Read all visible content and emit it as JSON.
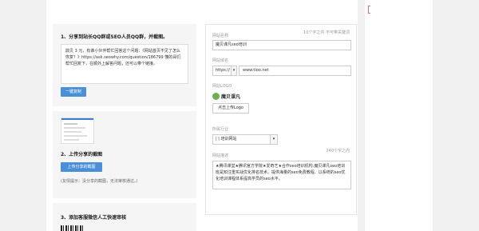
{
  "step1": {
    "title": "1、分享到站长QQ群或SEO人员QQ群，并截图。",
    "share_text": "鼎贝 3 元，有谁小伙伴帮忙回答这个问题：《网站首页不见了怎么恢复？》https://ask.seowhy.com/question/186799 懂的哥们帮忙回复下，在顺外上解答问题，还可以带个链接。",
    "copy_button": "一键复制"
  },
  "step2": {
    "title": "2、上传分享的截图",
    "upload_button": "上传分享的截图",
    "hint": "(友情提示：没分享的截图，无法审核通过。)"
  },
  "step3": {
    "title": "3、添加客服微信人工快速审核"
  },
  "form": {
    "site_name_label": "网站名称",
    "site_name_note": "10个字之内 不可带关键词",
    "site_name_value": "魔贝课凡seo培训",
    "domain_label": "网站域名",
    "protocol_value": "https://",
    "domain_value": "www.tioo.net",
    "logo_label": "网站LOGO",
    "logo_name": "魔贝课凡",
    "logo_upload_button": "点击上传Logo",
    "industry_label": "所属行业",
    "industry_value": "| | 培训网站",
    "description_label": "网站描述",
    "description_note": "240个字之内",
    "description_value": "★腾讯课堂★腾讯官方学院★爱奇艺★合作seo培训机构:魔贝课凡seo培训班是知注重实战优化排名技术。提供海量的seo免费教程、以系统的seo优化培训课程体系提高学员的seo水平。"
  }
}
